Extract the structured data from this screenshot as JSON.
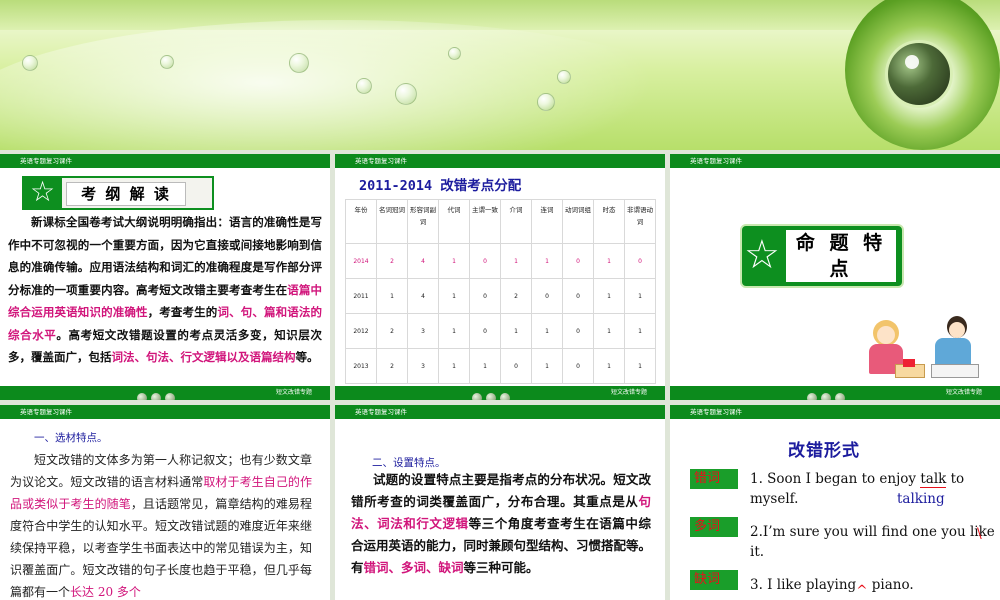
{
  "slide1": {
    "header": "英语专题复习课件",
    "title": "考 纲 解 读",
    "para_parts": [
      "新课标全国卷考试大纲说明明确指出：语言的准确性是写作中不可忽视的一个重要方面，因为它直接或间接地影响到信息的准确传输。应用语法结构和词汇的准确程度是写作部分评分标准的一项重要内容。高考短文改错主要考查考生在",
      "语篇中综合运用英语知识的准确性",
      "，考查考生的",
      "词、句、篇和语法的综合水平",
      "。高考短文改错题设置的考点灵活多变，知识层次多，覆盖面广，包括",
      "词法、句法、行文逻辑以及语篇结构",
      "等。"
    ],
    "footer": "短文改错专题"
  },
  "slide2": {
    "header": "英语专题复习课件",
    "title": "2011-2014 改错考点分配",
    "corner_label": "年份",
    "columns": [
      "名词冠词",
      "形容词副词",
      "代词",
      "主谓一致",
      "介词",
      "连词",
      "动词词组",
      "时态",
      "非谓语动词"
    ],
    "rows": [
      {
        "year": "2014",
        "values": [
          "2",
          "4",
          "1",
          "0",
          "1",
          "1",
          "0",
          "1",
          "0"
        ]
      },
      {
        "year": "2011",
        "values": [
          "1",
          "4",
          "1",
          "0",
          "2",
          "0",
          "0",
          "1",
          "1"
        ]
      },
      {
        "year": "2012",
        "values": [
          "2",
          "3",
          "1",
          "0",
          "1",
          "1",
          "0",
          "1",
          "1"
        ]
      },
      {
        "year": "2013",
        "values": [
          "2",
          "3",
          "1",
          "1",
          "0",
          "1",
          "0",
          "1",
          "1"
        ]
      }
    ],
    "footer": "短文改错专题"
  },
  "slide3": {
    "header": "英语专题复习课件",
    "title": "命 题 特 点",
    "footer": "短文改错专题"
  },
  "slide4": {
    "header": "英语专题复习课件",
    "subheading": "一、选材特点。",
    "para_parts": [
      "短文改错的文体多为第一人称记叙文；也有少数文章为议论文。短文改错的语言材料通常",
      "取材于考生自己的作品或类似于考生的随笔",
      "，且话题常见，篇章结构的难易程度符合中学生的认知水平。短文改错试题的难度近年来继续保持平稳，以考查学生书面表达中的常见错误为主，知识覆盖面广。短文改错的句子长度也趋于平稳，但几乎每篇都有一个",
      "长达 20 多个"
    ]
  },
  "slide5": {
    "header": "英语专题复习课件",
    "subheading": "二、设置特点。",
    "para_parts": [
      "试题的设置特点主要是指考点的分布状况。短文改错所考查的词类覆盖面广，分布合理。其重点是从",
      "句法、词法和行文逻辑",
      "等三个角度考查考生在语篇中综合运用英语的能力，同时兼顾句型结构、习惯搭配等。有",
      "错词、多词、缺词",
      "等三种可能。"
    ]
  },
  "slide6": {
    "header": "英语专题复习课件",
    "title": "改错形式",
    "items": [
      {
        "tag": "错词",
        "sentence_before": "1. Soon I began to enjoy ",
        "marked": "talk",
        "sentence_after": " to myself.",
        "correction": "talking"
      },
      {
        "tag": "多词",
        "sentence_before": "2.I’m sure you will find one you like ",
        "marked": "it.",
        "sentence_after": "",
        "correction": ""
      },
      {
        "tag": "缺词",
        "sentence_before": "3. I like playing",
        "marked": "^",
        "sentence_after": " piano.",
        "correction": ""
      }
    ]
  },
  "colors": {
    "header_green": "#0c8a1c",
    "highlight_pink": "#d1157b",
    "title_blue": "#1c1c9e"
  }
}
